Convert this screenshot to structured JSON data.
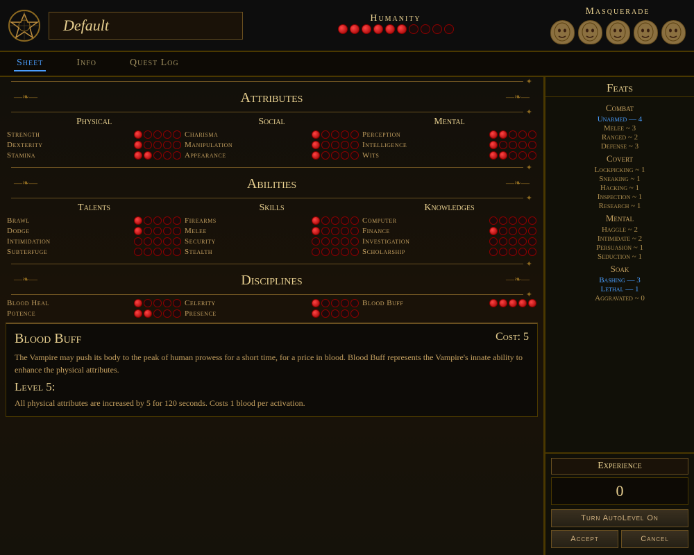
{
  "header": {
    "title": "Default",
    "humanity_label": "Humanity",
    "masquerade_label": "Masquerade",
    "humanity_dots": [
      true,
      true,
      true,
      true,
      true,
      true,
      false,
      false,
      false,
      false
    ],
    "masquerade_dots": [
      true,
      true,
      true,
      true,
      true
    ]
  },
  "nav": {
    "tabs": [
      "Sheet",
      "Info",
      "Quest Log"
    ],
    "active": "Sheet"
  },
  "attributes": {
    "section_label": "Attributes",
    "physical_label": "Physical",
    "social_label": "Social",
    "mental_label": "Mental",
    "stats": {
      "physical": [
        {
          "name": "Strength",
          "dots": [
            true,
            false,
            false,
            false,
            false
          ]
        },
        {
          "name": "Dexterity",
          "dots": [
            true,
            false,
            false,
            false,
            false
          ]
        },
        {
          "name": "Stamina",
          "dots": [
            true,
            true,
            false,
            false,
            false
          ]
        }
      ],
      "social": [
        {
          "name": "Charisma",
          "dots": [
            true,
            false,
            false,
            false,
            false
          ]
        },
        {
          "name": "Manipulation",
          "dots": [
            true,
            false,
            false,
            false,
            false
          ]
        },
        {
          "name": "Appearance",
          "dots": [
            true,
            false,
            false,
            false,
            false
          ]
        }
      ],
      "mental": [
        {
          "name": "Perception",
          "dots": [
            true,
            true,
            false,
            false,
            false
          ]
        },
        {
          "name": "Intelligence",
          "dots": [
            true,
            false,
            false,
            false,
            false
          ]
        },
        {
          "name": "Wits",
          "dots": [
            true,
            true,
            false,
            false,
            false
          ]
        }
      ]
    }
  },
  "abilities": {
    "section_label": "Abilities",
    "talents_label": "Talents",
    "skills_label": "Skills",
    "knowledges_label": "Knowledges",
    "stats": {
      "talents": [
        {
          "name": "Brawl",
          "dots": [
            true,
            false,
            false,
            false,
            false
          ]
        },
        {
          "name": "Dodge",
          "dots": [
            true,
            false,
            false,
            false,
            false
          ]
        },
        {
          "name": "Intimidation",
          "dots": [
            false,
            false,
            false,
            false,
            false
          ]
        },
        {
          "name": "Subterfuge",
          "dots": [
            false,
            false,
            false,
            false,
            false
          ]
        }
      ],
      "skills": [
        {
          "name": "Firearms",
          "dots": [
            true,
            false,
            false,
            false,
            false
          ]
        },
        {
          "name": "Melee",
          "dots": [
            true,
            false,
            false,
            false,
            false
          ]
        },
        {
          "name": "Security",
          "dots": [
            false,
            false,
            false,
            false,
            false
          ]
        },
        {
          "name": "Stealth",
          "dots": [
            false,
            false,
            false,
            false,
            false
          ]
        }
      ],
      "knowledges": [
        {
          "name": "Computer",
          "dots": [
            false,
            false,
            false,
            false,
            false
          ]
        },
        {
          "name": "Finance",
          "dots": [
            true,
            false,
            false,
            false,
            false
          ]
        },
        {
          "name": "Investigation",
          "dots": [
            false,
            false,
            false,
            false,
            false
          ]
        },
        {
          "name": "Scholarship",
          "dots": [
            false,
            false,
            false,
            false,
            false
          ]
        }
      ]
    }
  },
  "disciplines": {
    "section_label": "Disciplines",
    "stats": [
      {
        "name": "Blood Heal",
        "dots": [
          true,
          false,
          false,
          false,
          false
        ]
      },
      {
        "name": "Celerity",
        "dots": [
          true,
          false,
          false,
          false,
          false
        ]
      },
      {
        "name": "Blood Buff",
        "dots": [
          true,
          true,
          true,
          true,
          true
        ]
      },
      {
        "name": "Potence",
        "dots": [
          true,
          true,
          false,
          false,
          false
        ]
      },
      {
        "name": "Presence",
        "dots": [
          true,
          false,
          false,
          false,
          false
        ]
      }
    ]
  },
  "info_box": {
    "title": "Blood Buff",
    "cost_label": "Cost: 5",
    "description": "The Vampire may push its body to the peak of human prowess for a short time, for a price in blood. Blood Buff represents the Vampire's innate ability to enhance the physical attributes.",
    "level_label": "Level 5:",
    "level_description": "All physical attributes are increased by 5 for 120 seconds. Costs 1 blood per activation."
  },
  "feats": {
    "section_label": "Feats",
    "combat_label": "Combat",
    "combat_items": [
      {
        "name": "Unarmed — 4",
        "highlight": true
      },
      {
        "name": "Melee ~ 3",
        "highlight": false
      },
      {
        "name": "Ranged ~ 2",
        "highlight": false
      },
      {
        "name": "Defense ~ 3",
        "highlight": false
      }
    ],
    "covert_label": "Covert",
    "covert_items": [
      {
        "name": "Lockpicking ~ 1",
        "highlight": false
      },
      {
        "name": "Sneaking ~ 1",
        "highlight": false
      },
      {
        "name": "Hacking ~ 1",
        "highlight": false
      },
      {
        "name": "Inspection ~ 1",
        "highlight": false
      },
      {
        "name": "Research ~ 1",
        "highlight": false
      }
    ],
    "mental_label": "Mental",
    "mental_items": [
      {
        "name": "Haggle ~ 2",
        "highlight": false
      },
      {
        "name": "Intimidate ~ 2",
        "highlight": false
      },
      {
        "name": "Persuasion ~ 1",
        "highlight": false
      },
      {
        "name": "Seduction ~ 1",
        "highlight": false
      }
    ],
    "soak_label": "Soak",
    "soak_items": [
      {
        "name": "Bashing — 3",
        "highlight": true
      },
      {
        "name": "Lethal — 1",
        "highlight": true
      },
      {
        "name": "Aggravated ~ 0",
        "highlight": false
      }
    ]
  },
  "experience": {
    "label": "Experience",
    "value": "0",
    "autolevel_btn": "Turn AutoLevel On",
    "accept_btn": "Accept",
    "cancel_btn": "Cancel"
  }
}
